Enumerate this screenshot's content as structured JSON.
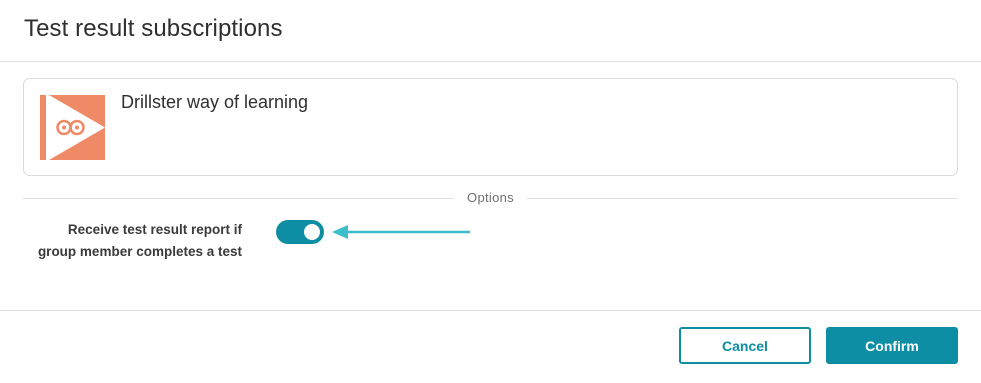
{
  "dialog": {
    "title": "Test result subscriptions"
  },
  "course": {
    "title": "Drillster way of learning",
    "thumbnail_icon": "drillster-logo-icon",
    "thumbnail_color": "#ef8a67"
  },
  "options": {
    "section_label": "Options",
    "toggle_label_line1": "Receive test result report if",
    "toggle_label_line2": "group member completes a test",
    "toggle_on": true
  },
  "annotation": {
    "icon": "arrow-left-icon",
    "color": "#3dbccb"
  },
  "footer": {
    "cancel_label": "Cancel",
    "confirm_label": "Confirm"
  },
  "colors": {
    "accent": "#0d8ea5",
    "border": "#dadada",
    "text": "#2f2f2f"
  }
}
